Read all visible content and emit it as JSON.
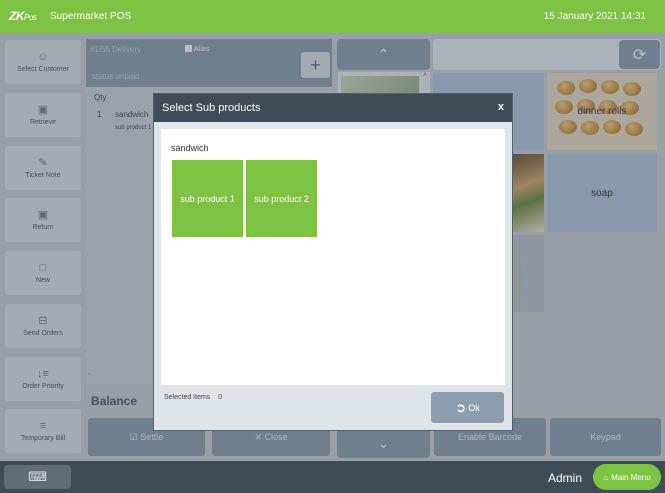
{
  "header": {
    "logo_main": "ZK",
    "logo_sub": "Pos",
    "app_title": "Supermarket POS",
    "datetime": "15 January 2021 14:31"
  },
  "sidebar": {
    "items": [
      {
        "label": "Select Customer",
        "icon": "person-icon"
      },
      {
        "label": "Retrieve",
        "icon": "retrieve-icon"
      },
      {
        "label": "Ticket Note",
        "icon": "note-icon"
      },
      {
        "label": "Return",
        "icon": "return-icon"
      },
      {
        "label": "New",
        "icon": "new-doc-icon"
      },
      {
        "label": "Send Orders",
        "icon": "send-icon"
      },
      {
        "label": "Order Priority",
        "icon": "priority-icon"
      },
      {
        "label": "Temporary Bill",
        "icon": "bill-icon"
      }
    ]
  },
  "order": {
    "header_line1": "#1/55 Delivery",
    "alias_label": "Alias",
    "header_line2": "status  unpaid",
    "qty_header": "Qty",
    "items": [
      {
        "qty": "1",
        "name": "sandwich",
        "sub": "sub product 1"
      }
    ],
    "balance_label": "Balance"
  },
  "bottom_buttons": {
    "settle": "Settle",
    "close": "Close",
    "enable_barcode": "Enable Barcode",
    "keypad": "Keypad"
  },
  "products": {
    "tiles": [
      {
        "label": "dinner rolls"
      },
      {
        "label": "soap"
      }
    ]
  },
  "modal": {
    "title": "Select Sub products",
    "close_label": "x",
    "group_label": "sandwich",
    "sub_products": [
      "sub product 1",
      "sub product 2"
    ],
    "selected_items_label": "Selected Items",
    "selected_items_count": "0",
    "ok_label": "Ok"
  },
  "footer": {
    "user": "Admin",
    "main_menu": "Main Menu"
  },
  "colors": {
    "accent_green": "#7dc242",
    "dark_slate": "#3e4c57",
    "button_blue_gray": "#8d9faf",
    "tile_blue": "#b2c6dc"
  }
}
